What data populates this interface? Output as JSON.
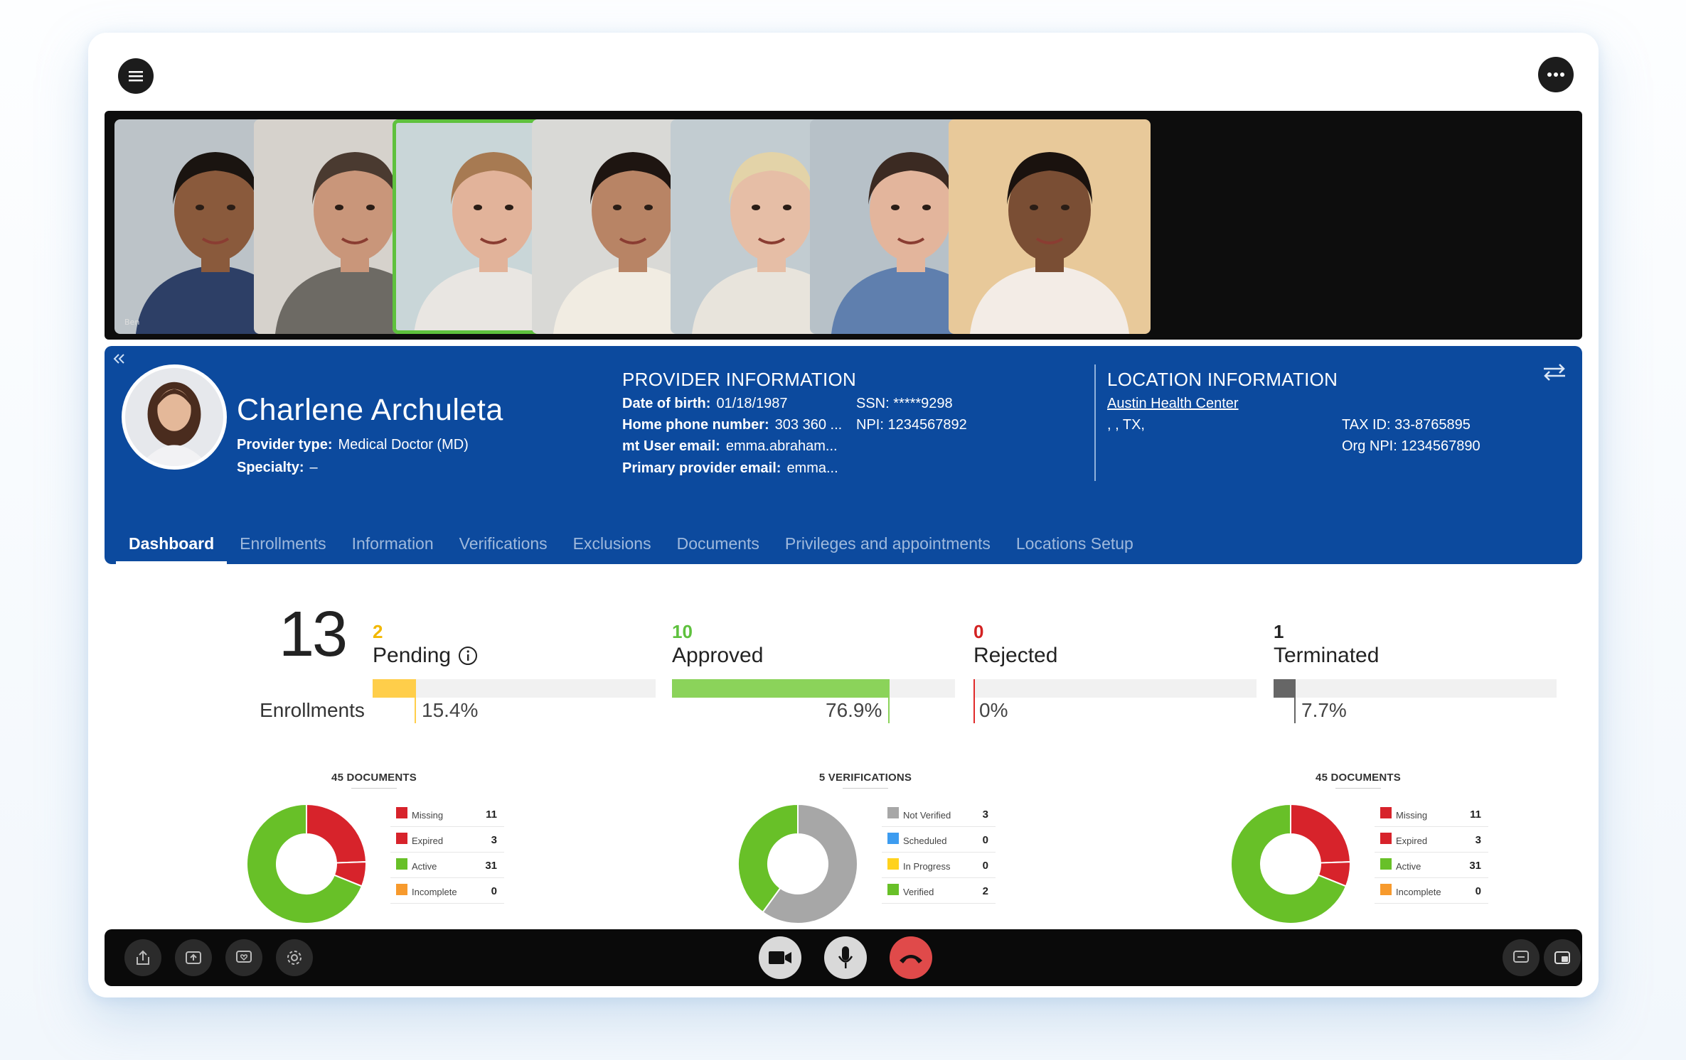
{
  "toolbar": {
    "menu_icon": "hamburger-icon",
    "more_icon": "ellipsis-icon"
  },
  "participants": [
    {
      "name": "Ben",
      "skin": "#8a5a3c",
      "hair": "#1a1410",
      "shirt": "#2d3f66",
      "bg": "#bcc3c8"
    },
    {
      "name": "",
      "skin": "#c9967a",
      "hair": "#4a3a30",
      "shirt": "#6d6a64",
      "bg": "#d6d2cc"
    },
    {
      "name": "",
      "skin": "#e2b39a",
      "hair": "#a77a52",
      "shirt": "#e9e6e2",
      "bg": "#c9d6d8"
    },
    {
      "name": "",
      "skin": "#b88465",
      "hair": "#1e1511",
      "shirt": "#f1ece2",
      "bg": "#d9d9d6"
    },
    {
      "name": "",
      "skin": "#e6bea6",
      "hair": "#e3d3a8",
      "shirt": "#e8e4dc",
      "bg": "#c2ccd1"
    },
    {
      "name": "",
      "skin": "#e3b59c",
      "hair": "#3b2a22",
      "shirt": "#5f7fae",
      "bg": "#b7c1c8"
    },
    {
      "name": "",
      "skin": "#7a4e34",
      "hair": "#1a120e",
      "shirt": "#f3ece6",
      "bg": "#e8c99a"
    }
  ],
  "provider": {
    "name": "Charlene Archuleta",
    "provider_type_label": "Provider type:",
    "provider_type": "Medical Doctor (MD)",
    "specialty_label": "Specialty:",
    "specialty": "–"
  },
  "provider_info": {
    "heading": "PROVIDER INFORMATION",
    "dob_label": "Date of birth:",
    "dob": "01/18/1987",
    "ssn_label": "SSN:",
    "ssn": "*****9298",
    "phone_label": "Home phone number:",
    "phone": "303 360 ...",
    "npi_label": "NPI:",
    "npi": "1234567892",
    "mt_email_label": "mt User email:",
    "mt_email": "emma.abraham...",
    "primary_email_label": "Primary provider email:",
    "primary_email": "emma..."
  },
  "location_info": {
    "heading": "LOCATION INFORMATION",
    "center": "Austin Health Center",
    "address": ", , TX,",
    "taxid_label": "TAX ID:",
    "taxid": "33-8765895",
    "orgnpi_label": "Org NPI:",
    "orgnpi": "1234567890"
  },
  "tabs": [
    "Dashboard",
    "Enrollments",
    "Information",
    "Verifications",
    "Exclusions",
    "Documents",
    "Privileges and appointments",
    "Locations Setup"
  ],
  "enrollments": {
    "total": "13",
    "label": "Enrollments"
  },
  "stats": [
    {
      "count": "2",
      "label": "Pending",
      "percent": "15.4%",
      "fraction": 0.154,
      "color": "#ffce4a",
      "count_color": "#f2b800",
      "info": true
    },
    {
      "count": "10",
      "label": "Approved",
      "percent": "76.9%",
      "fraction": 0.769,
      "color": "#8bd35a",
      "count_color": "#5ec13d",
      "info": false
    },
    {
      "count": "0",
      "label": "Rejected",
      "percent": "0%",
      "fraction": 0,
      "color": "#e02a2a",
      "count_color": "#d32222",
      "info": false
    },
    {
      "count": "1",
      "label": "Terminated",
      "percent": "7.7%",
      "fraction": 0.077,
      "color": "#666666",
      "count_color": "#222222",
      "info": false
    }
  ],
  "chart_data": [
    {
      "type": "pie",
      "title": "45 DOCUMENTS",
      "categories": [
        "Missing",
        "Expired",
        "Active",
        "Incomplete"
      ],
      "values": [
        11,
        3,
        31,
        0
      ],
      "colors": [
        "#d7232b",
        "#d7232b",
        "#68c028",
        "#f79a2d"
      ]
    },
    {
      "type": "pie",
      "title": "5 VERIFICATIONS",
      "categories": [
        "Not Verified",
        "Scheduled",
        "In Progress",
        "Verified"
      ],
      "values": [
        3,
        0,
        0,
        2
      ],
      "colors": [
        "#a7a7a7",
        "#3d9cf0",
        "#ffd21e",
        "#68c028"
      ]
    },
    {
      "type": "pie",
      "title": "45 DOCUMENTS",
      "categories": [
        "Missing",
        "Expired",
        "Active",
        "Incomplete"
      ],
      "values": [
        11,
        3,
        31,
        0
      ],
      "colors": [
        "#d7232b",
        "#d7232b",
        "#68c028",
        "#f79a2d"
      ]
    }
  ],
  "call_controls": {
    "left": [
      "share-icon",
      "upload-icon",
      "heart-chat-icon",
      "gear-icon"
    ],
    "center": [
      "video-camera-icon",
      "microphone-icon",
      "hang-up-icon"
    ],
    "right": [
      "chat-icon",
      "picture-in-picture-icon"
    ],
    "hangup_color": "#e04a4a"
  }
}
